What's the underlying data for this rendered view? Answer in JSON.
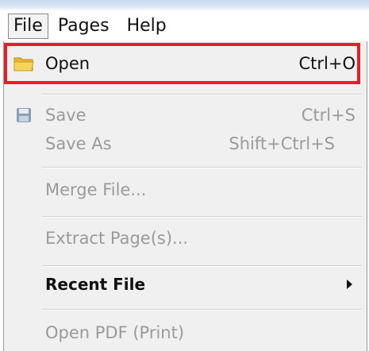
{
  "menubar": {
    "menus": [
      {
        "label": "File"
      },
      {
        "label": "Pages"
      },
      {
        "label": "Help"
      }
    ]
  },
  "file_menu": {
    "open": {
      "label": "Open",
      "shortcut": "Ctrl+O",
      "icon": "folder-icon"
    },
    "save": {
      "label": "Save",
      "shortcut": "Ctrl+S",
      "icon": "disk-icon"
    },
    "save_as": {
      "label": "Save As",
      "shortcut": "Shift+Ctrl+S"
    },
    "merge": {
      "label": "Merge File..."
    },
    "extract": {
      "label": "Extract Page(s)..."
    },
    "recent": {
      "label": "Recent File"
    },
    "open_pdf_print": {
      "label": "Open PDF (Print)"
    }
  },
  "colors": {
    "highlight_border": "#e41f28",
    "disabled_text": "#9a9a9a",
    "menu_background": "#f0f0f0"
  }
}
